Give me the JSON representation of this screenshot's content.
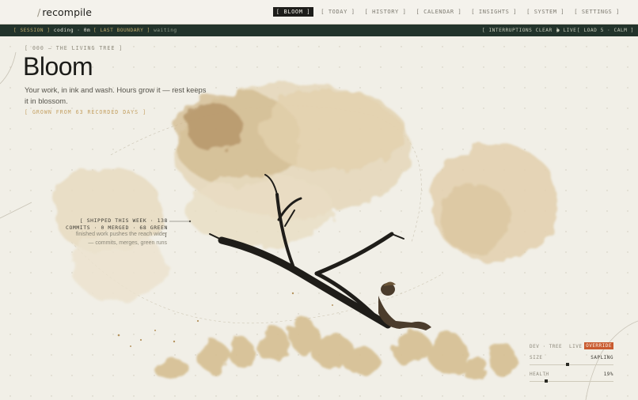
{
  "brand": {
    "slash": "/",
    "name": "recompile"
  },
  "nav": [
    {
      "label": "[ BLOOM ]",
      "active": true
    },
    {
      "label": "[ TODAY ]",
      "active": false
    },
    {
      "label": "[ HISTORY ]",
      "active": false
    },
    {
      "label": "[ CALENDAR ]",
      "active": false
    },
    {
      "label": "[ INSIGHTS ]",
      "active": false
    },
    {
      "label": "[ SYSTEM ]",
      "active": false
    },
    {
      "label": "[ SETTINGS ]",
      "active": false
    }
  ],
  "status": {
    "session_key": "[ SESSION ]",
    "session_value": "coding · 0m",
    "boundary_key": "[ LAST BOUNDARY ]",
    "boundary_value": "waiting",
    "interruptions": "[ INTERRUPTIONS CLEAR ]",
    "live": "● LIVE",
    "load": "[ LOAD 5 · CALM ]"
  },
  "hero": {
    "kicker": "[ 000 — THE LIVING TREE ]",
    "title": "Bloom",
    "description": "Your work, in ink and wash. Hours grow it — rest keeps it in blossom.",
    "tag": "[ GROWN FROM 63 RECORDED DAYS ]"
  },
  "annotation": {
    "title": "[ SHIPPED THIS WEEK · 138 COMMITS · 0 MERGED · 68 GREEN ]",
    "body": "finished work pushes the reach wider — commits, merges, green runs"
  },
  "dev_panel": {
    "title": "DEV · TREE",
    "live": "LIVE",
    "override": "OVERRIDE",
    "size_label": "SIZE",
    "size_value": "SAPLING",
    "size_level": 0.45,
    "health_label": "HEALTH",
    "health_value": "19%",
    "health_level": 0.19
  },
  "colors": {
    "background": "#f1efe7",
    "statusbar": "#22332b",
    "accent_override": "#c95b30",
    "tag_gold": "#c4a062",
    "ink": "#1c1c19"
  }
}
